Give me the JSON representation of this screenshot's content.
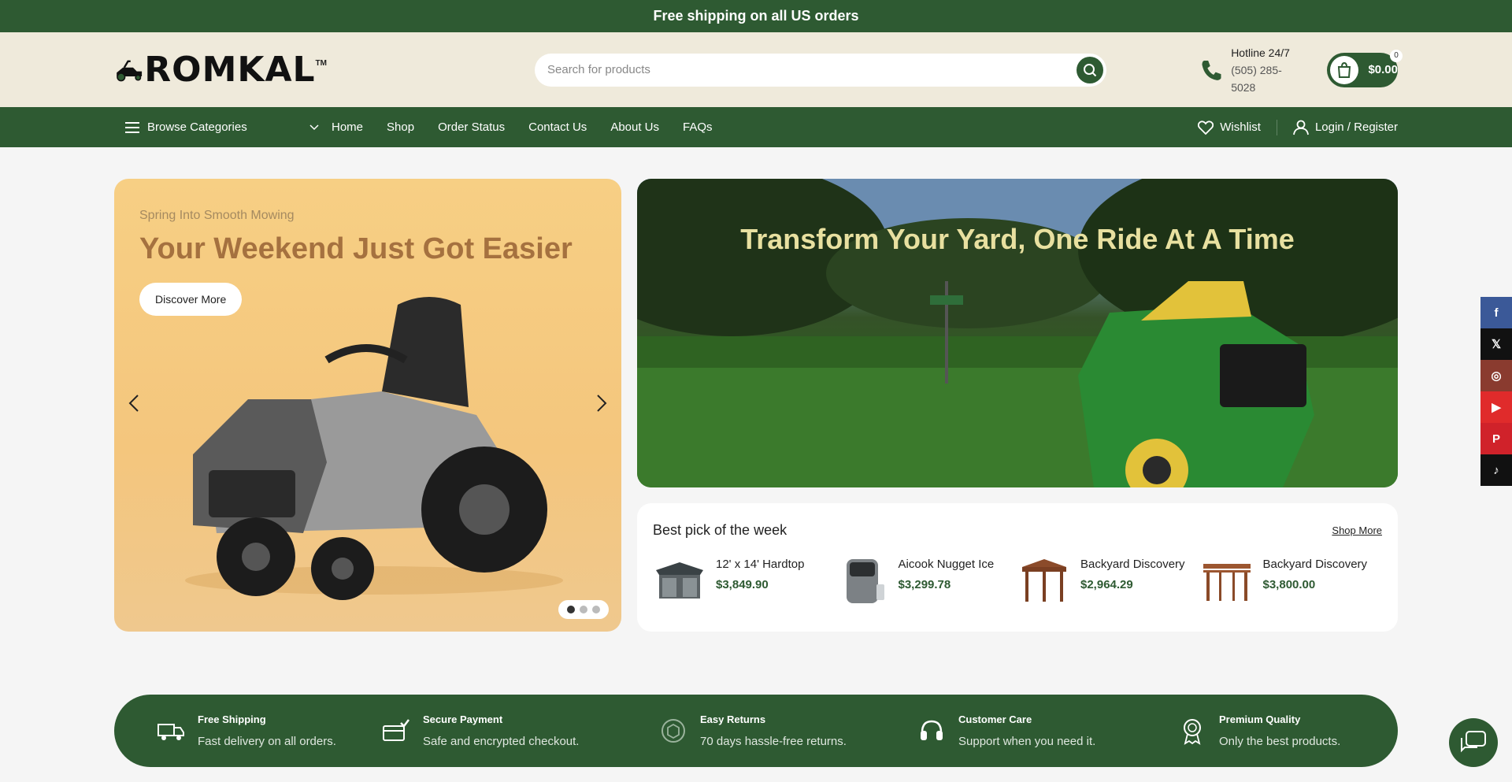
{
  "topbar": {
    "text": "Free shipping on all US orders"
  },
  "header": {
    "logo_text": "ROMKAL",
    "logo_tm": "TM",
    "search_placeholder": "Search for products",
    "hotline_title": "Hotline 24/7",
    "hotline_phone": "(505) 285-5028",
    "cart_total": "$0.00",
    "cart_count": "0"
  },
  "nav": {
    "browse_label": "Browse Categories",
    "links": [
      "Home",
      "Shop",
      "Order Status",
      "Contact Us",
      "About Us",
      "FAQs"
    ],
    "wishlist": "Wishlist",
    "login": "Login / Register"
  },
  "hero_left": {
    "eyebrow": "Spring Into Smooth Mowing",
    "title": "Your Weekend Just Got Easier",
    "button": "Discover More",
    "slides_total": 3,
    "active_slide": 1
  },
  "hero_right": {
    "title": "Transform Your Yard, One Ride At A Time"
  },
  "bestpick": {
    "title": "Best pick of the week",
    "more": "Shop More",
    "items": [
      {
        "name": "12' x 14' Hardtop",
        "price": "$3,849.90"
      },
      {
        "name": "Aicook Nugget Ice",
        "price": "$3,299.78"
      },
      {
        "name": "Backyard Discovery",
        "price": "$2,964.29"
      },
      {
        "name": "Backyard Discovery",
        "price": "$3,800.00"
      }
    ]
  },
  "features": [
    {
      "title": "Free Shipping",
      "desc": "Fast delivery on all orders."
    },
    {
      "title": "Secure Payment",
      "desc": "Safe and encrypted checkout."
    },
    {
      "title": "Easy Returns",
      "desc": "70 days hassle-free returns."
    },
    {
      "title": "Customer Care",
      "desc": "Support when you need it."
    },
    {
      "title": "Premium Quality",
      "desc": "Only the best products."
    }
  ],
  "social": [
    {
      "name": "facebook",
      "glyph": "f",
      "color": "#3b5998"
    },
    {
      "name": "x",
      "glyph": "𝕏",
      "color": "#111111"
    },
    {
      "name": "instagram",
      "glyph": "◎",
      "color": "#8a3b2f"
    },
    {
      "name": "youtube",
      "glyph": "▶",
      "color": "#e02b2b"
    },
    {
      "name": "pinterest",
      "glyph": "P",
      "color": "#d0222a"
    },
    {
      "name": "tiktok",
      "glyph": "♪",
      "color": "#111111"
    }
  ],
  "colors": {
    "brand": "#2e5a32",
    "header_bg": "#efeadb",
    "hero_left_bg": "#f6c97f"
  }
}
